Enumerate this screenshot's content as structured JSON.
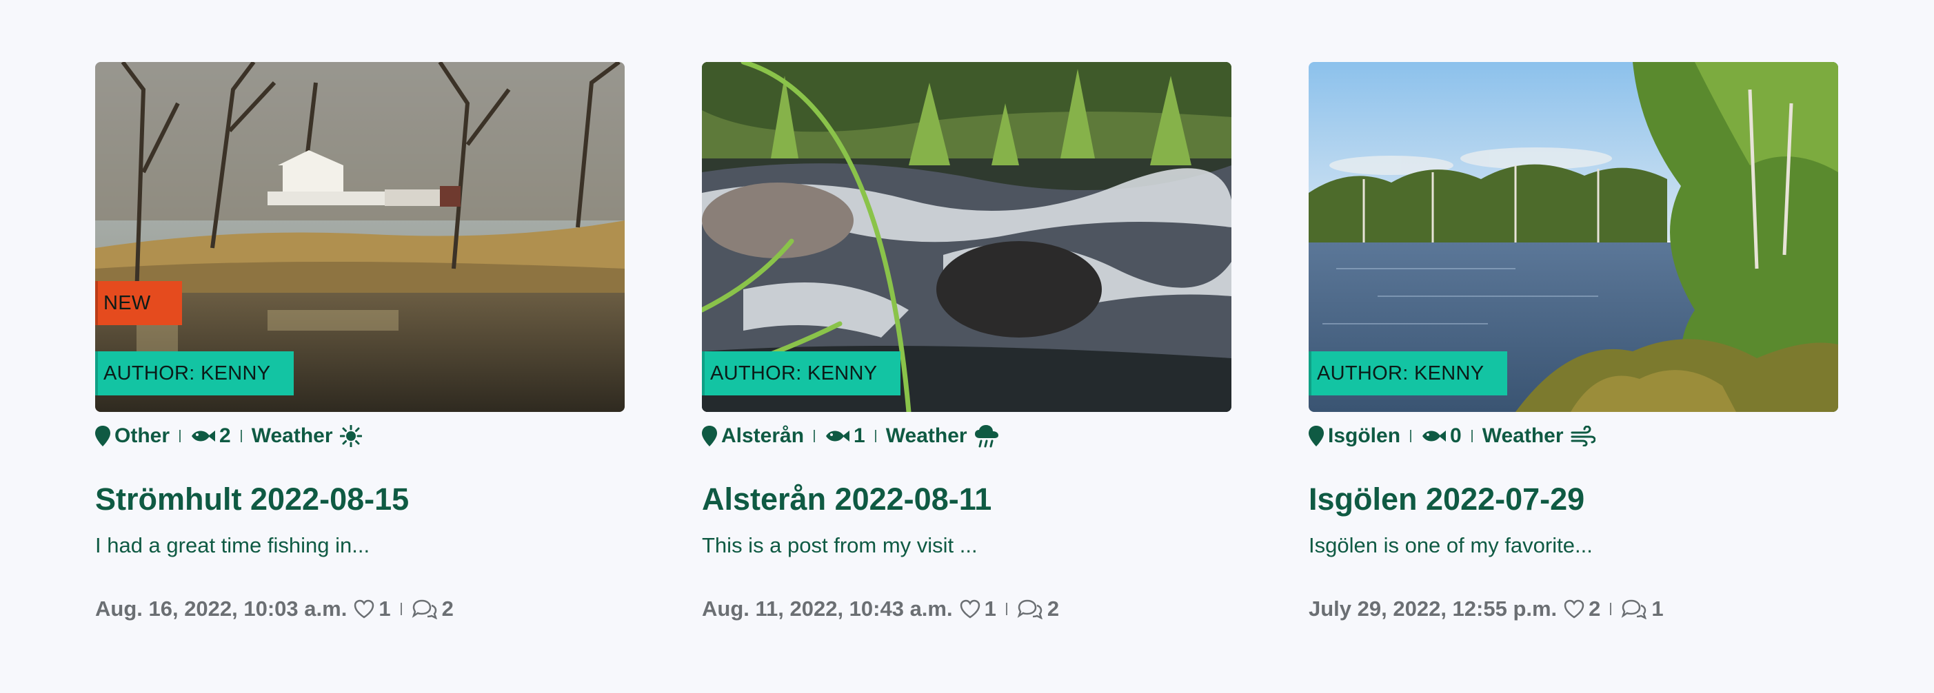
{
  "colors": {
    "brand_green": "#0f5a43",
    "new_tag": "#e54b1e",
    "author_tag": "#13c4a3",
    "muted_text": "#6b6f73",
    "background": "#f7f8fc"
  },
  "cards": [
    {
      "image_subject": "lake-with-white-cabin",
      "new_label": "NEW",
      "author_label": "AUTHOR: KENNY",
      "location": "Other",
      "fish_count": "2",
      "weather_label": "Weather",
      "weather_icon": "sun-icon",
      "title": "Strömhult 2022-08-15",
      "excerpt": "I had a great time fishing in...",
      "date": "Aug. 16, 2022, 10:03 a.m.",
      "likes": "1",
      "comments": "2"
    },
    {
      "image_subject": "rushing-stream",
      "author_label": "AUTHOR: KENNY",
      "location": "Alsterån",
      "fish_count": "1",
      "weather_label": "Weather",
      "weather_icon": "rain-cloud-icon",
      "title": "Alsterån 2022-08-11",
      "excerpt": "This is a post from my visit ...",
      "date": "Aug. 11, 2022, 10:43 a.m.",
      "likes": "1",
      "comments": "2"
    },
    {
      "image_subject": "forest-lake",
      "author_label": "AUTHOR: KENNY",
      "location": "Isgölen",
      "fish_count": "0",
      "weather_label": "Weather",
      "weather_icon": "wind-icon",
      "title": "Isgölen 2022-07-29",
      "excerpt": "Isgölen is one of my favorite...",
      "date": "July 29, 2022, 12:55 p.m.",
      "likes": "2",
      "comments": "1"
    }
  ]
}
